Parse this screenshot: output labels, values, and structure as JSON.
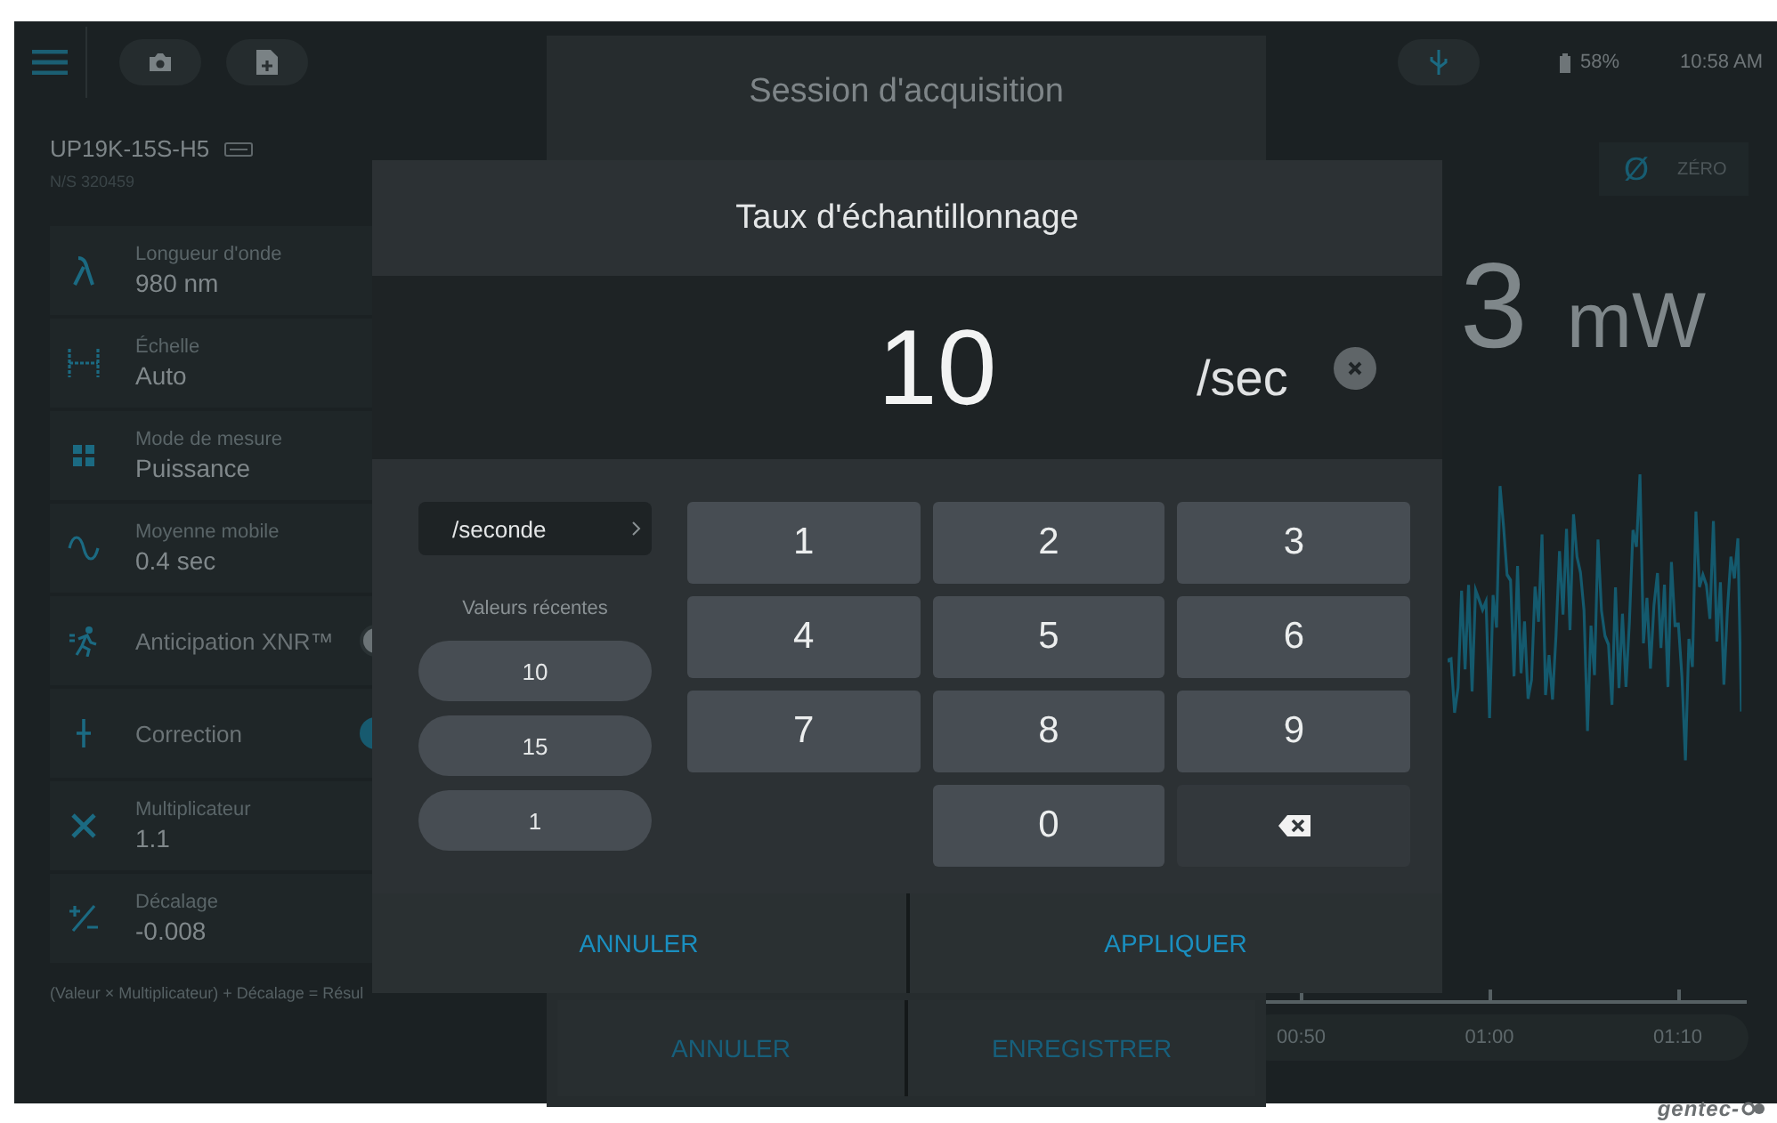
{
  "top_bar": {
    "battery": "58%",
    "time": "10:58 AM"
  },
  "device": {
    "model": "UP19K-15S-H5",
    "serial": "N/S 320459"
  },
  "settings": [
    {
      "kind": "value",
      "label": "Longueur d'onde",
      "value": "980 nm"
    },
    {
      "kind": "value",
      "label": "Échelle",
      "value": "Auto"
    },
    {
      "kind": "value",
      "label": "Mode de mesure",
      "value": "Puissance"
    },
    {
      "kind": "value",
      "label": "Moyenne mobile",
      "value": "0.4 sec"
    },
    {
      "kind": "toggle",
      "label": "Anticipation XNR™",
      "on": false
    },
    {
      "kind": "toggle",
      "label": "Correction",
      "on": true
    },
    {
      "kind": "value",
      "label": "Multiplicateur",
      "value": "1.1"
    },
    {
      "kind": "value",
      "label": "Décalage",
      "value": "-0.008"
    }
  ],
  "formula": "(Valeur × Multiplicateur) + Décalage = Résul",
  "zero_button": {
    "symbol": "Ø",
    "label": "ZÉRO"
  },
  "reading": {
    "value": "3",
    "unit": "mW"
  },
  "time_axis": {
    "labels": [
      "00:50",
      "01:00",
      "01:10"
    ]
  },
  "session_dialog": {
    "title": "Session d'acquisition",
    "buttons": [
      "ANNULER",
      "ENREGISTRER"
    ]
  },
  "rate_dialog": {
    "title": "Taux d'échantillonnage",
    "value": "10",
    "unit": "/sec",
    "unit_selector": "/seconde",
    "recent_label": "Valeurs récentes",
    "recent_values": [
      "10",
      "15",
      "1"
    ],
    "keys": [
      {
        "kind": "digit",
        "label": "1"
      },
      {
        "kind": "digit",
        "label": "2"
      },
      {
        "kind": "digit",
        "label": "3"
      },
      {
        "kind": "digit",
        "label": "4"
      },
      {
        "kind": "digit",
        "label": "5"
      },
      {
        "kind": "digit",
        "label": "6"
      },
      {
        "kind": "digit",
        "label": "7"
      },
      {
        "kind": "digit",
        "label": "8"
      },
      {
        "kind": "digit",
        "label": "9"
      },
      {
        "kind": "blank"
      },
      {
        "kind": "digit",
        "label": "0"
      },
      {
        "kind": "backspace"
      }
    ],
    "buttons": [
      "ANNULER",
      "APPLIQUER"
    ]
  },
  "brand": "gentec-"
}
